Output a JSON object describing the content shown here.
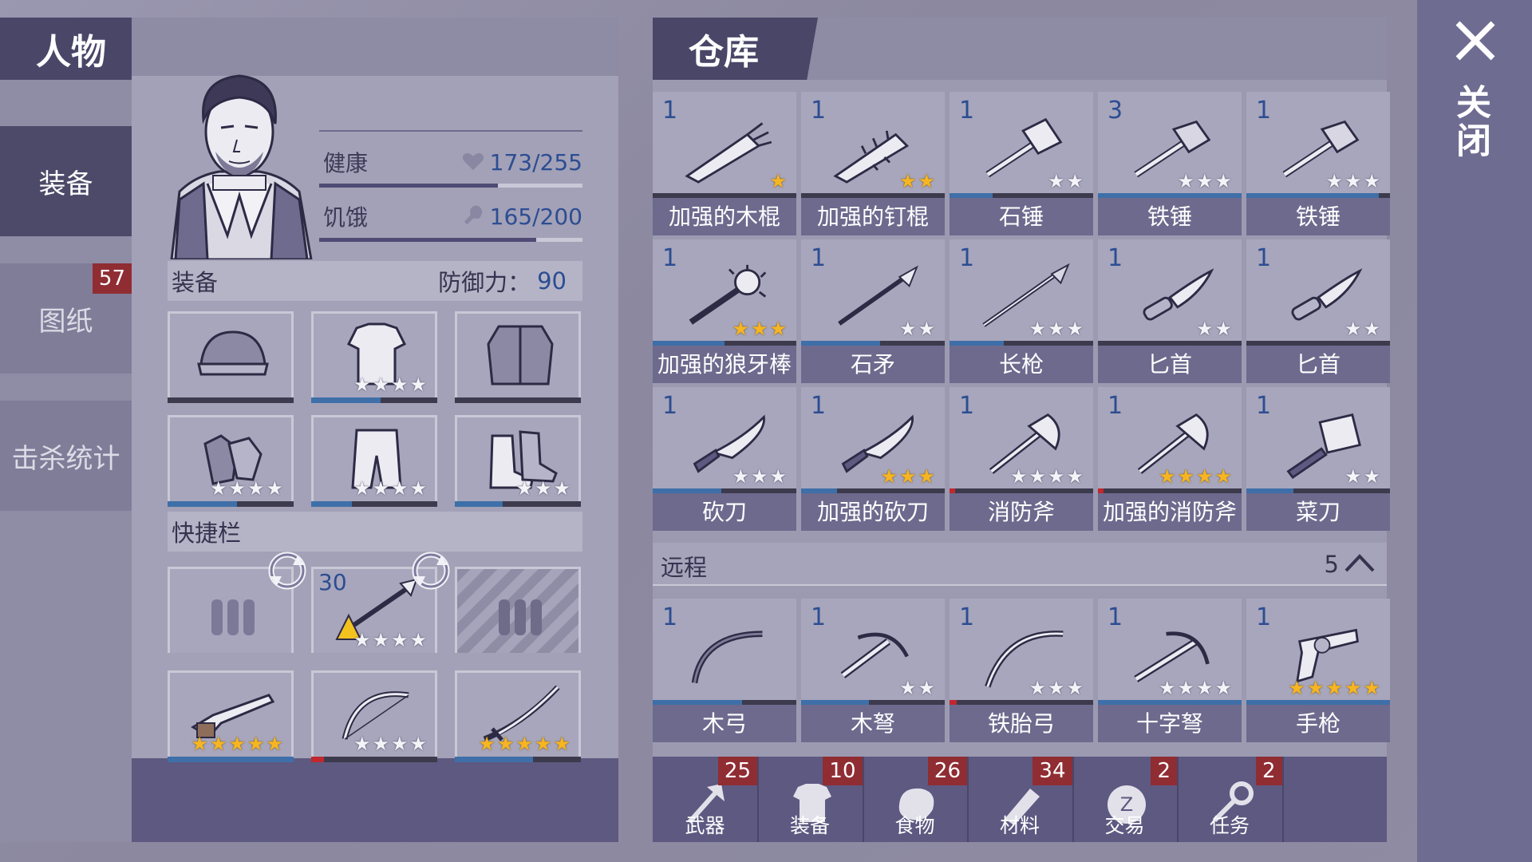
{
  "sidebar": {
    "character_title": "人物",
    "tabs": [
      {
        "label": "装备",
        "active": true
      },
      {
        "label": "图纸",
        "badge": "57"
      },
      {
        "label": "击杀统计"
      }
    ]
  },
  "character": {
    "health_label": "健康",
    "health_value": "173/255",
    "health_fraction": 0.68,
    "hunger_label": "饥饿",
    "hunger_value": "165/200",
    "hunger_fraction": 0.825
  },
  "equipment": {
    "label": "装备",
    "defense_label": "防御力：",
    "defense_value": "90",
    "slots": [
      {
        "icon": "beanie-icon",
        "stars": 0,
        "dur": 0
      },
      {
        "icon": "shirt-icon",
        "stars": 4,
        "gold": 0,
        "dur": 0.55
      },
      {
        "icon": "jacket-icon",
        "stars": 0,
        "dur": 0
      },
      {
        "icon": "gloves-icon",
        "stars": 4,
        "gold": 0,
        "dur": 0.55
      },
      {
        "icon": "pants-icon",
        "stars": 4,
        "gold": 0,
        "dur": 0.32
      },
      {
        "icon": "boots-icon",
        "stars": 3,
        "gold": 0,
        "dur": 0.38
      }
    ]
  },
  "quickbar": {
    "label": "快捷栏",
    "slots": [
      {
        "icon": "ammo-icon",
        "stars": 0
      },
      {
        "icon": "spear-fire-icon",
        "count": "30",
        "stars": 4,
        "gold": 0
      },
      {
        "icon": "ammo-locked-icon",
        "stars": 0,
        "locked": true
      },
      {
        "icon": "shotgun-icon",
        "stars": 5,
        "gold": 5,
        "dur": 1.0
      },
      {
        "icon": "bow-icon",
        "stars": 4,
        "gold": 0,
        "dur": 0.1,
        "dur_color": "#c0282e"
      },
      {
        "icon": "katana-icon",
        "stars": 5,
        "gold": 5,
        "dur": 0.62
      }
    ]
  },
  "warehouse": {
    "title": "仓库",
    "melee": [
      {
        "qty": "1",
        "name": "加强的木棍",
        "icon": "reinforced-club-icon",
        "stars": 1,
        "gold": 1,
        "dur": 0
      },
      {
        "qty": "1",
        "name": "加强的钉棍",
        "icon": "spiked-club-icon",
        "stars": 2,
        "gold": 2,
        "dur": 0
      },
      {
        "qty": "1",
        "name": "石锤",
        "icon": "stone-hammer-icon",
        "stars": 2,
        "gold": 0,
        "dur": 0.3
      },
      {
        "qty": "3",
        "name": "铁锤",
        "icon": "iron-hammer-icon",
        "stars": 3,
        "gold": 0,
        "dur": 1.0
      },
      {
        "qty": "1",
        "name": "铁锤",
        "icon": "iron-hammer-icon",
        "stars": 3,
        "gold": 0,
        "dur": 0.92
      },
      {
        "qty": "1",
        "name": "加强的狼牙棒",
        "icon": "spiked-mace-icon",
        "stars": 3,
        "gold": 3,
        "dur": 0.5
      },
      {
        "qty": "1",
        "name": "石矛",
        "icon": "stone-spear-icon",
        "stars": 2,
        "gold": 0,
        "dur": 0.55
      },
      {
        "qty": "1",
        "name": "长枪",
        "icon": "long-spear-icon",
        "stars": 3,
        "gold": 0,
        "dur": 0.38
      },
      {
        "qty": "1",
        "name": "匕首",
        "icon": "dagger-icon",
        "stars": 2,
        "gold": 0,
        "dur": 0
      },
      {
        "qty": "1",
        "name": "匕首",
        "icon": "dagger-icon",
        "stars": 2,
        "gold": 0,
        "dur": 0
      },
      {
        "qty": "1",
        "name": "砍刀",
        "icon": "machete-icon",
        "stars": 3,
        "gold": 0,
        "dur": 0.48
      },
      {
        "qty": "1",
        "name": "加强的砍刀",
        "icon": "machete-icon",
        "stars": 3,
        "gold": 3,
        "dur": 0.25
      },
      {
        "qty": "1",
        "name": "消防斧",
        "icon": "fire-axe-icon",
        "stars": 4,
        "gold": 0,
        "dur": 0.04,
        "dur_color": "#c0282e"
      },
      {
        "qty": "1",
        "name": "加强的消防斧",
        "icon": "fire-axe-icon",
        "stars": 4,
        "gold": 4,
        "dur": 0.04,
        "dur_color": "#c0282e"
      },
      {
        "qty": "1",
        "name": "菜刀",
        "icon": "cleaver-icon",
        "stars": 2,
        "gold": 0,
        "dur": 0.33
      }
    ],
    "ranged_label": "远程",
    "ranged_count": "5",
    "ranged": [
      {
        "qty": "1",
        "name": "木弓",
        "icon": "wooden-bow-icon",
        "stars": 0,
        "gold": 0,
        "dur": 0.62
      },
      {
        "qty": "1",
        "name": "木弩",
        "icon": "wooden-crossbow-icon",
        "stars": 2,
        "gold": 0,
        "dur": 0.47
      },
      {
        "qty": "1",
        "name": "铁胎弓",
        "icon": "iron-bow-icon",
        "stars": 3,
        "gold": 0,
        "dur": 0.05,
        "dur_color": "#c0282e"
      },
      {
        "qty": "1",
        "name": "十字弩",
        "icon": "crossbow-icon",
        "stars": 4,
        "gold": 0,
        "dur": 1.0
      },
      {
        "qty": "1",
        "name": "手枪",
        "icon": "revolver-icon",
        "stars": 5,
        "gold": 5,
        "dur": 1.0
      }
    ],
    "tabs": [
      {
        "label": "武器",
        "count": "25",
        "icon": "axe-icon"
      },
      {
        "label": "装备",
        "count": "10",
        "icon": "shirt-icon"
      },
      {
        "label": "食物",
        "count": "26",
        "icon": "meat-icon"
      },
      {
        "label": "材料",
        "count": "34",
        "icon": "wood-icon"
      },
      {
        "label": "交易",
        "count": "2",
        "icon": "coin-icon"
      },
      {
        "label": "任务",
        "count": "2",
        "icon": "key-icon"
      }
    ]
  },
  "close_label": "关闭"
}
